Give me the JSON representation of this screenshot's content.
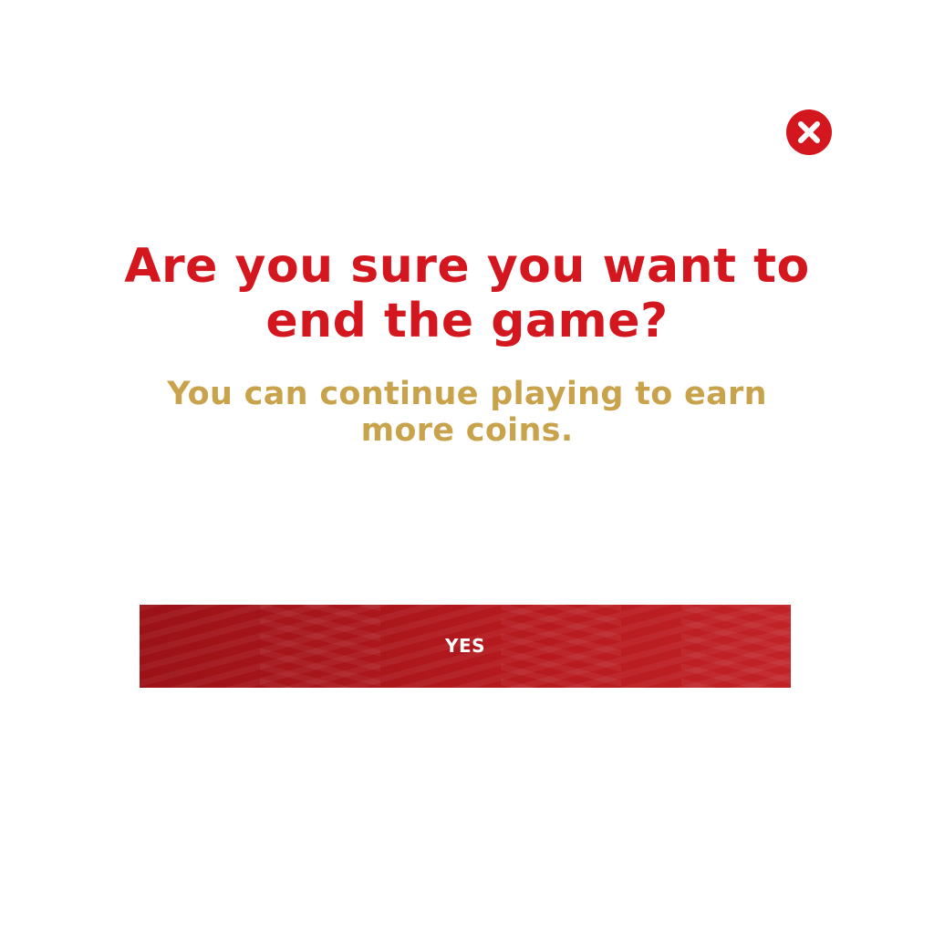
{
  "dialog": {
    "title": "Are you sure you want to end the game?",
    "subtitle": "You can continue playing to earn more coins.",
    "yes_label": "YES",
    "close_icon": "close-circle-icon"
  },
  "colors": {
    "title": "#d4171e",
    "subtitle": "#c9a34b",
    "button": "#b01a1f",
    "close": "#d4171e"
  }
}
